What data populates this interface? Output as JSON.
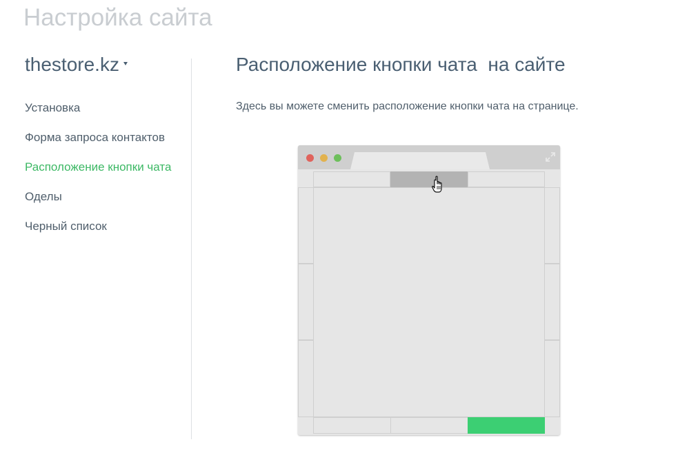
{
  "page": {
    "heading": "Настройка сайта"
  },
  "site_selector": {
    "value": "thestore.kz"
  },
  "nav": {
    "items": [
      {
        "label": "Установка"
      },
      {
        "label": "Форма запроса контактов"
      },
      {
        "label": "Расположение кнопки чата"
      },
      {
        "label": "Оделы"
      },
      {
        "label": "Черный список"
      }
    ],
    "active_index": 2
  },
  "section": {
    "title": "Расположение кнопки чата  на сайте",
    "description": "Здесь вы можете сменить расположение кнопки чата на странице."
  },
  "position_picker": {
    "hover_position": "top-center",
    "selected_position": "bottom-right"
  },
  "colors": {
    "accent_green": "#3cb864",
    "selected_slot": "#3ccf73",
    "hover_slot": "#b3b3b3",
    "heading_gray": "#c9cdd1",
    "text_dark": "#4a5f72"
  },
  "icons": {
    "caret": "caret-down-icon",
    "expand": "expand-icon",
    "cursor": "hand-pointer-icon"
  }
}
